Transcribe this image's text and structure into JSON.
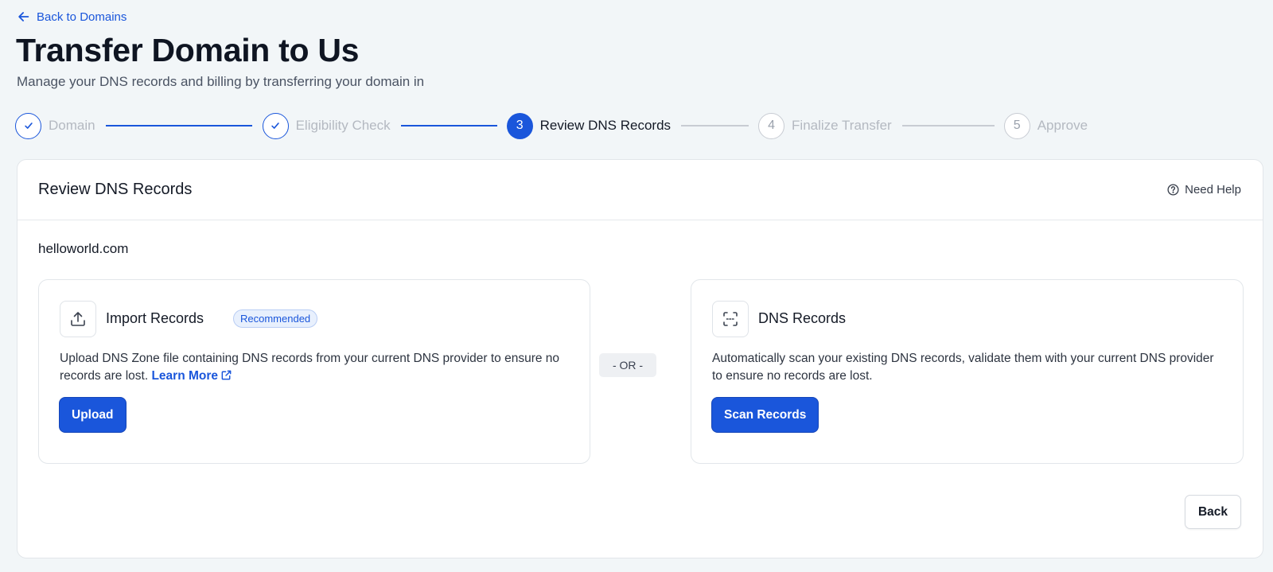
{
  "nav": {
    "back_label": "Back to Domains"
  },
  "header": {
    "title": "Transfer Domain to Us",
    "subtitle": "Manage your DNS records and billing by transferring your domain in"
  },
  "stepper": {
    "steps": [
      {
        "number": "1",
        "label": "Domain",
        "status": "completed"
      },
      {
        "number": "2",
        "label": "Eligibility Check",
        "status": "completed"
      },
      {
        "number": "3",
        "label": "Review DNS Records",
        "status": "active"
      },
      {
        "number": "4",
        "label": "Finalize Transfer",
        "status": "pending"
      },
      {
        "number": "5",
        "label": "Approve",
        "status": "pending"
      }
    ]
  },
  "card": {
    "title": "Review DNS Records",
    "help_label": "Need Help",
    "domain": "helloworld.com",
    "import_option": {
      "title": "Import Records",
      "badge": "Recommended",
      "description": "Upload DNS Zone file containing DNS records from your current DNS provider to ensure no records are lost.",
      "learn_more": "Learn More",
      "button_label": "Upload",
      "icon": "upload-icon"
    },
    "divider_label": "- OR -",
    "scan_option": {
      "title": "DNS Records",
      "description": "Automatically scan your existing DNS records, validate them with your current DNS provider to ensure no records are lost.",
      "button_label": "Scan Records",
      "icon": "scan-icon"
    },
    "back_button_label": "Back"
  },
  "colors": {
    "primary": "#1a56db",
    "background": "#f2f6f8",
    "pending": "#c8ccd3"
  }
}
